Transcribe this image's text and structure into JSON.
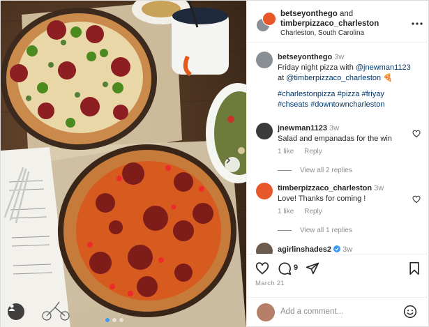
{
  "header": {
    "author": "betseyonthego",
    "and": "and",
    "collaborator": "timberpizzaco_charleston",
    "location": "Charleston, South Carolina",
    "more_icon": "more-horizontal-icon"
  },
  "caption": {
    "user": "betseyonthego",
    "time": "3w",
    "text_before": "Friday night pizza with ",
    "mention1": "@jnewman1123",
    "text_at": "at ",
    "mention2": "@timberpizzaco_charleston",
    "emoji": "🍕",
    "hashtags_line1": "#charlestonpizza #pizza #friyay",
    "hashtags_line2": "#chseats #downtowncharleston"
  },
  "comments": [
    {
      "user": "jnewman1123",
      "time": "3w",
      "text": "Salad and empanadas for the win",
      "likes": "1 like",
      "reply": "Reply",
      "view_replies": "View all 2 replies"
    },
    {
      "user": "timberpizzaco_charleston",
      "time": "3w",
      "text": "Love! Thanks for coming !",
      "likes": "1 like",
      "reply": "Reply",
      "view_replies": "View all 1 replies"
    },
    {
      "user": "agirlinshades2",
      "time": "3w"
    }
  ],
  "actions": {
    "like_count": "9",
    "date": "March 21"
  },
  "add_comment": {
    "placeholder": "Add a comment..."
  },
  "colors": {
    "link": "#00376b",
    "muted": "#8e8e8e",
    "brand_orange": "#e8572a",
    "verified": "#3897f0"
  }
}
